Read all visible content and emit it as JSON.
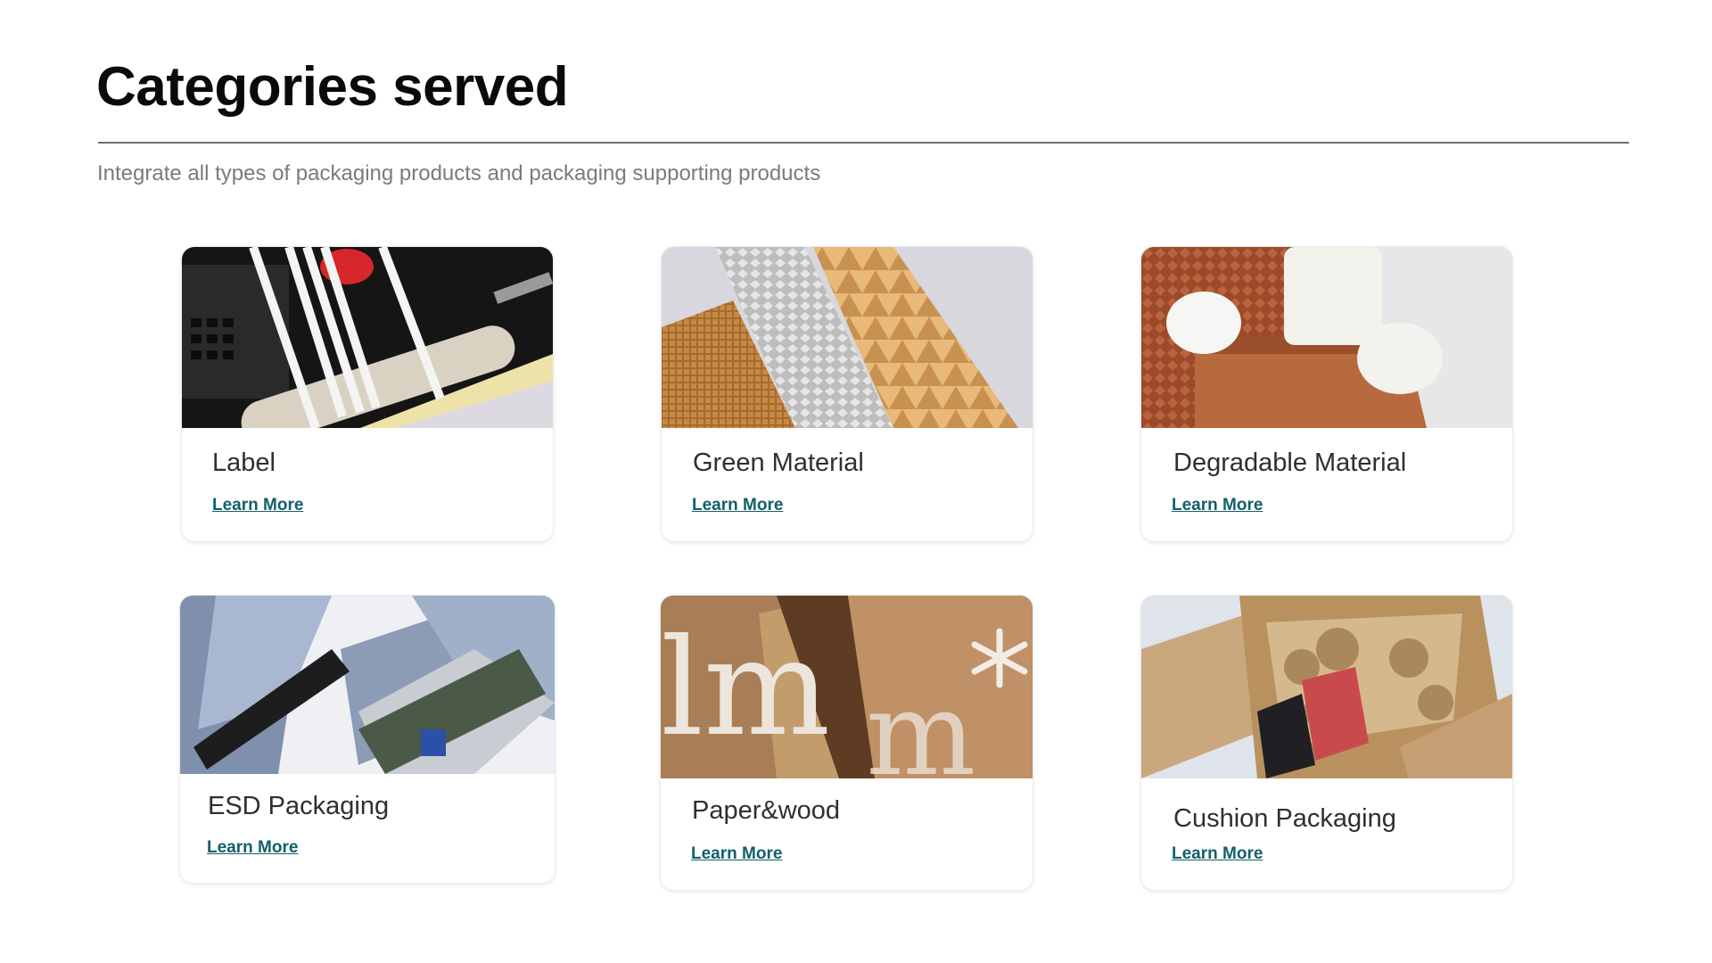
{
  "page": {
    "title": "Categories served",
    "subtitle": "Integrate all types of packaging products and packaging supporting products"
  },
  "colors": {
    "link": "#12606a",
    "divider": "#6f6f6f",
    "subtitle": "#7b7b7b"
  },
  "categories": [
    {
      "title": "Label",
      "link": "Learn More"
    },
    {
      "title": "Green Material",
      "link": "Learn More"
    },
    {
      "title": "Degradable Material",
      "link": "Learn More"
    },
    {
      "title": "ESD Packaging",
      "link": "Learn More"
    },
    {
      "title": "Paper&wood",
      "link": "Learn More"
    },
    {
      "title": "Cushion Packaging",
      "link": "Learn More"
    }
  ]
}
